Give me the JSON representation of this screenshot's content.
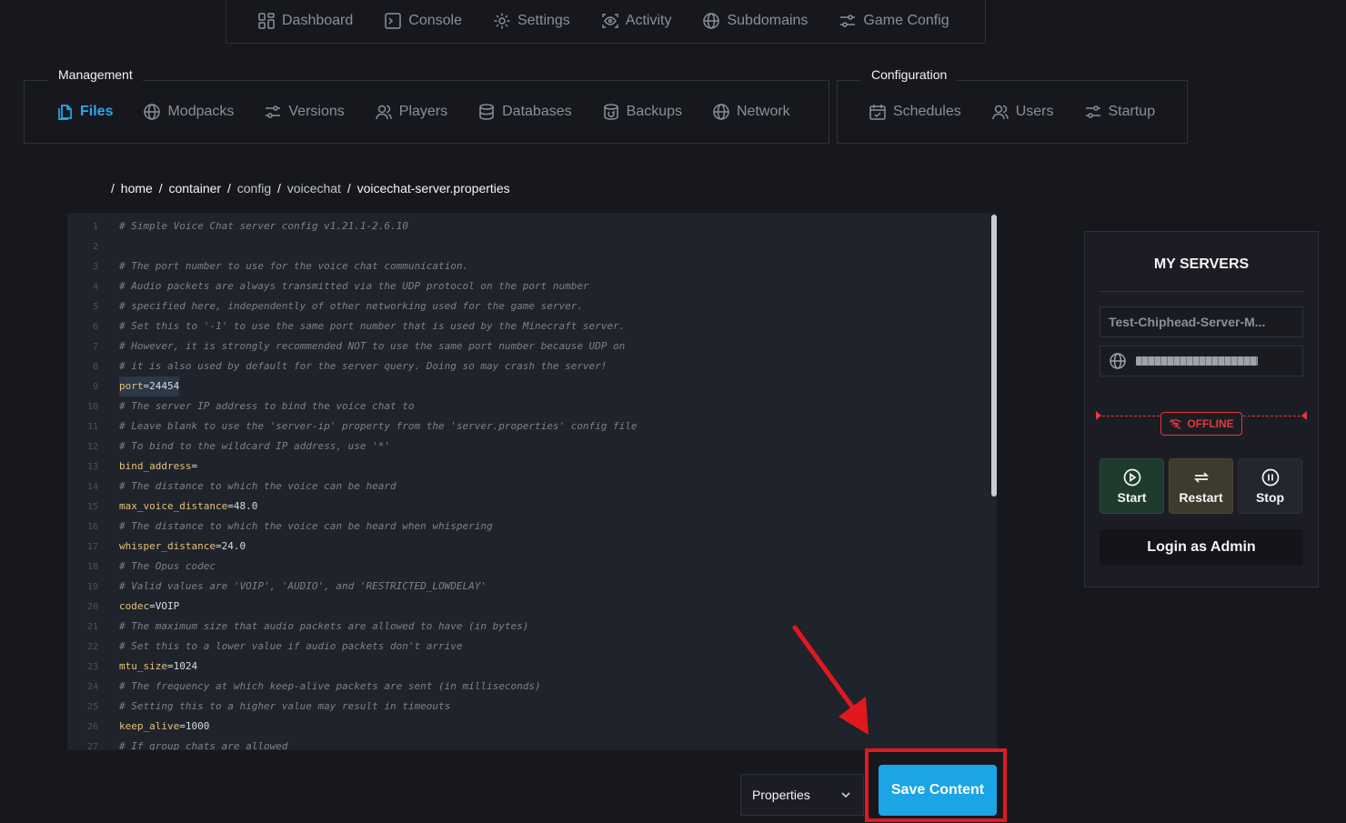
{
  "top_nav": [
    {
      "label": "Dashboard",
      "icon": "grid-icon"
    },
    {
      "label": "Console",
      "icon": "terminal-icon"
    },
    {
      "label": "Settings",
      "icon": "gear-icon"
    },
    {
      "label": "Activity",
      "icon": "eye-icon"
    },
    {
      "label": "Subdomains",
      "icon": "globe-icon"
    },
    {
      "label": "Game Config",
      "icon": "sliders-icon"
    }
  ],
  "management": {
    "legend": "Management",
    "items": [
      {
        "label": "Files",
        "icon": "files-icon",
        "active": true
      },
      {
        "label": "Modpacks",
        "icon": "globe-icon"
      },
      {
        "label": "Versions",
        "icon": "sliders-icon"
      },
      {
        "label": "Players",
        "icon": "users-icon"
      },
      {
        "label": "Databases",
        "icon": "database-icon"
      },
      {
        "label": "Backups",
        "icon": "backup-icon"
      },
      {
        "label": "Network",
        "icon": "globe-icon"
      }
    ]
  },
  "configuration": {
    "legend": "Configuration",
    "items": [
      {
        "label": "Schedules",
        "icon": "calendar-icon"
      },
      {
        "label": "Users",
        "icon": "users-icon"
      },
      {
        "label": "Startup",
        "icon": "sliders-icon"
      }
    ]
  },
  "breadcrumb": [
    "/",
    "home",
    "/",
    "container",
    "/",
    "config",
    "/",
    "voicechat",
    "/",
    "voicechat-server.properties"
  ],
  "editor": {
    "lines": [
      {
        "n": "1",
        "t": "c",
        "text": "# Simple Voice Chat server config v1.21.1-2.6.10"
      },
      {
        "n": "2",
        "t": "c",
        "text": ""
      },
      {
        "n": "3",
        "t": "c",
        "text": "# The port number to use for the voice chat communication."
      },
      {
        "n": "4",
        "t": "c",
        "text": "# Audio packets are always transmitted via the UDP protocol on the port number"
      },
      {
        "n": "5",
        "t": "c",
        "text": "# specified here, independently of other networking used for the game server."
      },
      {
        "n": "6",
        "t": "c",
        "text": "# Set this to '-1' to use the same port number that is used by the Minecraft server."
      },
      {
        "n": "7",
        "t": "c",
        "text": "# However, it is strongly recommended NOT to use the same port number because UDP on"
      },
      {
        "n": "8",
        "t": "c",
        "text": "# it is also used by default for the server query. Doing so may crash the server!"
      },
      {
        "n": "9",
        "t": "kv",
        "key": "port",
        "val": "24454",
        "hl": true
      },
      {
        "n": "10",
        "t": "c",
        "text": "# The server IP address to bind the voice chat to"
      },
      {
        "n": "11",
        "t": "c",
        "text": "# Leave blank to use the 'server-ip' property from the 'server.properties' config file"
      },
      {
        "n": "12",
        "t": "c",
        "text": "# To bind to the wildcard IP address, use '*'"
      },
      {
        "n": "13",
        "t": "kv",
        "key": "bind_address",
        "val": ""
      },
      {
        "n": "14",
        "t": "c",
        "text": "# The distance to which the voice can be heard"
      },
      {
        "n": "15",
        "t": "kv",
        "key": "max_voice_distance",
        "val": "48.0"
      },
      {
        "n": "16",
        "t": "c",
        "text": "# The distance to which the voice can be heard when whispering"
      },
      {
        "n": "17",
        "t": "kv",
        "key": "whisper_distance",
        "val": "24.0"
      },
      {
        "n": "18",
        "t": "c",
        "text": "# The Opus codec"
      },
      {
        "n": "19",
        "t": "c",
        "text": "# Valid values are 'VOIP', 'AUDIO', and 'RESTRICTED_LOWDELAY'"
      },
      {
        "n": "20",
        "t": "kv",
        "key": "codec",
        "val": "VOIP"
      },
      {
        "n": "21",
        "t": "c",
        "text": "# The maximum size that audio packets are allowed to have (in bytes)"
      },
      {
        "n": "22",
        "t": "c",
        "text": "# Set this to a lower value if audio packets don't arrive"
      },
      {
        "n": "23",
        "t": "kv",
        "key": "mtu_size",
        "val": "1024"
      },
      {
        "n": "24",
        "t": "c",
        "text": "# The frequency at which keep-alive packets are sent (in milliseconds)"
      },
      {
        "n": "25",
        "t": "c",
        "text": "# Setting this to a higher value may result in timeouts"
      },
      {
        "n": "26",
        "t": "kv",
        "key": "keep_alive",
        "val": "1000"
      },
      {
        "n": "27",
        "t": "c",
        "text": "# If group chats are allowed"
      }
    ]
  },
  "servers": {
    "title": "MY SERVERS",
    "server_name": "Test-Chiphead-Server-M...",
    "status": "OFFLINE",
    "start_label": "Start",
    "restart_label": "Restart",
    "stop_label": "Stop",
    "admin_label": "Login as Admin"
  },
  "footer": {
    "syntax_select": "Properties",
    "save_label": "Save Content"
  },
  "colors": {
    "accent": "#1ba4e6",
    "active_tab": "#29a9ef",
    "offline": "#e0393c",
    "annotation": "#e1191f"
  }
}
